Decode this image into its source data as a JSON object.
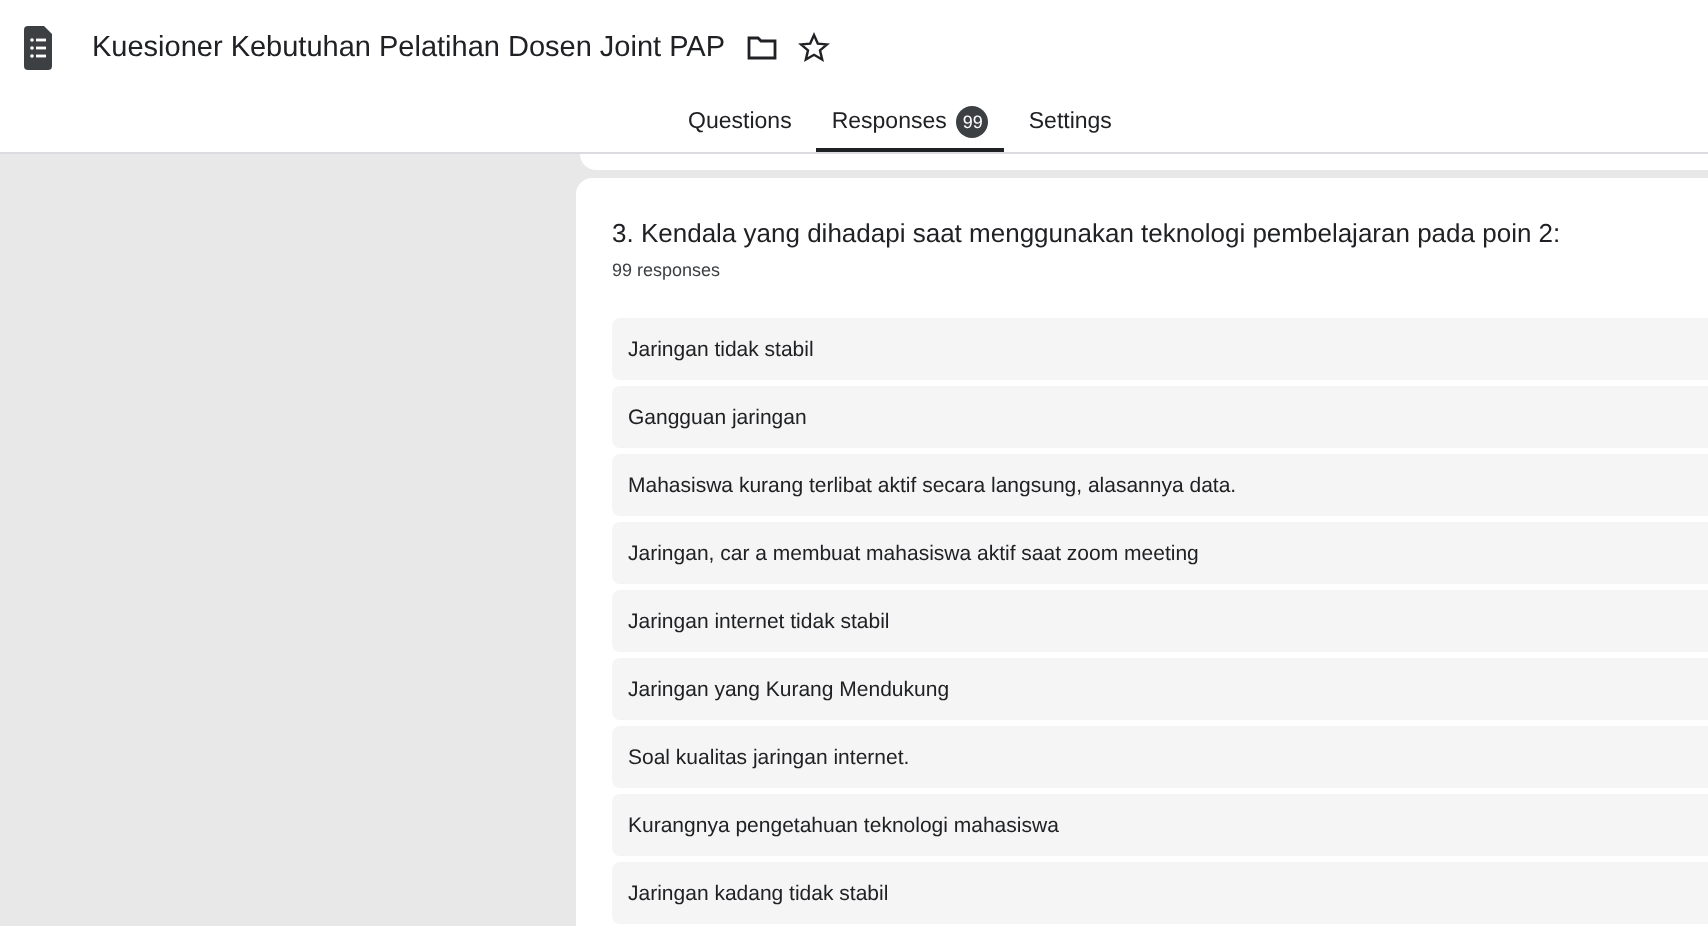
{
  "header": {
    "title": "Kuesioner Kebutuhan Pelatihan Dosen Joint PAP"
  },
  "tabs": [
    {
      "label": "Questions",
      "selected": false
    },
    {
      "label": "Responses",
      "selected": true,
      "badge": "99"
    },
    {
      "label": "Settings",
      "selected": false
    }
  ],
  "question": {
    "title": "3. Kendala yang dihadapi saat menggunakan teknologi pembelajaran pada poin 2:",
    "count": "99 responses",
    "responses": [
      "Jaringan tidak stabil",
      "Gangguan jaringan",
      "Mahasiswa kurang terlibat aktif secara langsung, alasannya data.",
      "Jaringan, car a membuat mahasiswa aktif saat zoom meeting",
      "Jaringan internet tidak stabil",
      "Jaringan yang Kurang Mendukung",
      "Soal kualitas jaringan internet.",
      "Kurangnya pengetahuan teknologi mahasiswa",
      "Jaringan kadang tidak stabil"
    ]
  }
}
